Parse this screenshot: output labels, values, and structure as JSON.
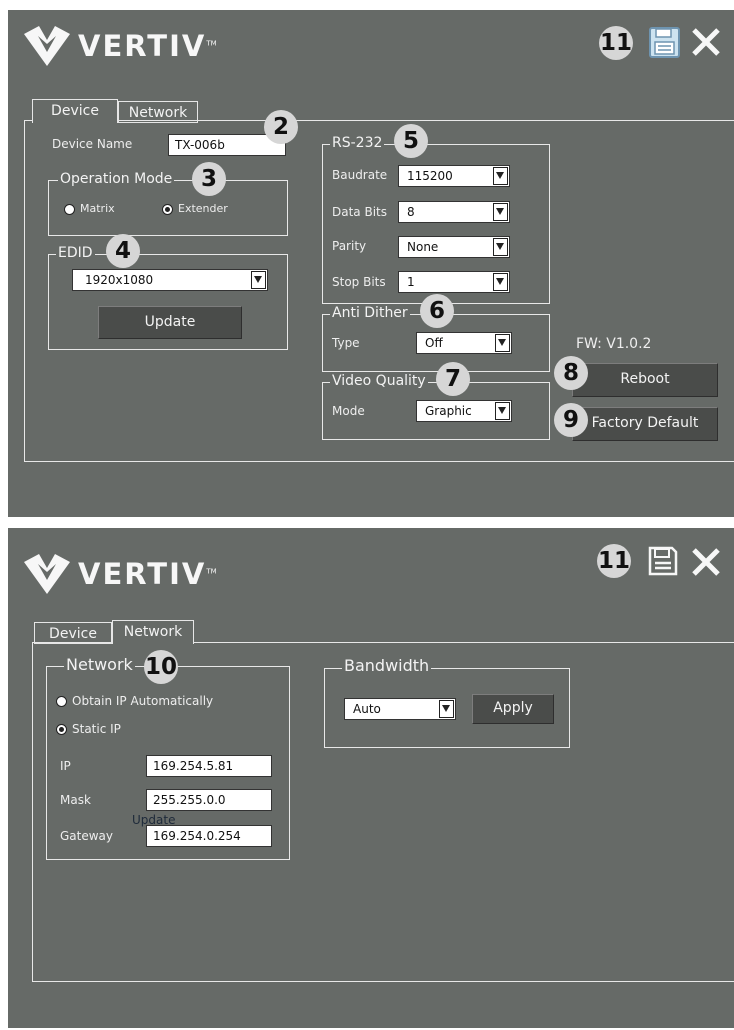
{
  "brand": {
    "name": "VERTIV",
    "tm": "TM"
  },
  "callouts": [
    "2",
    "3",
    "4",
    "5",
    "6",
    "7",
    "8",
    "9",
    "10",
    "11"
  ],
  "panel1": {
    "tabs": {
      "device": "Device",
      "network": "Network"
    },
    "device_name": {
      "label": "Device Name",
      "value": "TX-006b"
    },
    "operation_mode": {
      "title": "Operation Mode",
      "options": [
        "Matrix",
        "Extender"
      ],
      "selected": "Extender"
    },
    "edid": {
      "title": "EDID",
      "value": "1920x1080",
      "button": "Update"
    },
    "rs232": {
      "title": "RS-232",
      "baudrate": {
        "label": "Baudrate",
        "value": "115200"
      },
      "data_bits": {
        "label": "Data Bits",
        "value": "8"
      },
      "parity": {
        "label": "Parity",
        "value": "None"
      },
      "stop_bits": {
        "label": "Stop Bits",
        "value": "1"
      }
    },
    "anti_dither": {
      "title": "Anti Dither",
      "label": "Type",
      "value": "Off"
    },
    "video_quality": {
      "title": "Video Quality",
      "label": "Mode",
      "value": "Graphic"
    },
    "fw": "FW: V1.0.2",
    "reboot": "Reboot",
    "factory_default": "Factory Default"
  },
  "panel2": {
    "tabs": {
      "device": "Device",
      "network": "Network"
    },
    "network": {
      "title": "Network",
      "obtain_auto": "Obtain IP Automatically",
      "static_ip": "Static IP",
      "selected": "Static IP",
      "ip": {
        "label": "IP",
        "value": "169.254.5.81"
      },
      "mask": {
        "label": "Mask",
        "value": "255.255.0.0"
      },
      "gateway": {
        "label": "Gateway",
        "value": "169.254.0.254"
      },
      "overlay_text": "Update"
    },
    "bandwidth": {
      "title": "Bandwidth",
      "value": "Auto",
      "button": "Apply"
    }
  },
  "colors": {
    "panel_bg": "#666a67",
    "button_bg": "#4a4c4a",
    "badge_bg": "#d6d6d6"
  },
  "icons": [
    "vertiv-logo-icon",
    "save-icon",
    "close-icon",
    "chevron-down-icon"
  ]
}
